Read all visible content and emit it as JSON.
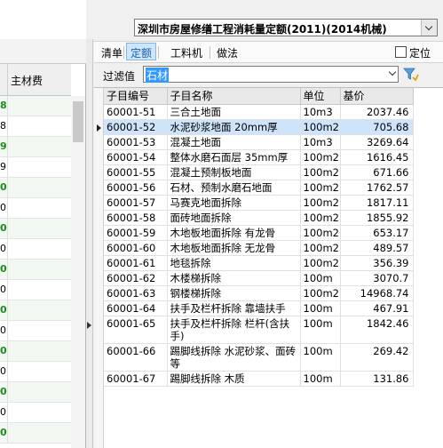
{
  "left_panel": {
    "column_header": "主材费",
    "rows": [
      {
        "text": "8",
        "green": true
      },
      {
        "text": "8",
        "green": false
      },
      {
        "text": "9",
        "green": true
      },
      {
        "text": "9",
        "green": false
      },
      {
        "text": "0",
        "green": true
      },
      {
        "text": "0",
        "green": false
      },
      {
        "text": "0",
        "green": true
      },
      {
        "text": "0",
        "green": false
      },
      {
        "text": "0",
        "green": true
      },
      {
        "text": "0",
        "green": false
      },
      {
        "text": "0",
        "green": true
      },
      {
        "text": "0",
        "green": false
      },
      {
        "text": "0",
        "green": true
      },
      {
        "text": "0",
        "green": false
      },
      {
        "text": "0",
        "green": true
      },
      {
        "text": "0",
        "green": false
      },
      {
        "text": "0",
        "green": true
      }
    ]
  },
  "quota_selector": {
    "value": "深圳市房屋修缮工程消耗量定额(2011)(2014机械)"
  },
  "toolbar": {
    "tabs": [
      {
        "label": "清单",
        "active": false
      },
      {
        "label": "定额",
        "active": true
      },
      {
        "label": "工料机",
        "active": false
      },
      {
        "label": "做法",
        "active": false
      }
    ],
    "locate_label": "定位",
    "locate_checked": false
  },
  "filter": {
    "label": "过滤值",
    "value": "石材"
  },
  "table": {
    "columns": [
      "子目编号",
      "子目名称",
      "单位",
      "基价"
    ],
    "selected_index": 1,
    "rows": [
      {
        "code": "60001-51",
        "name": "三合土地面",
        "unit": "10m3",
        "price": "2037.46"
      },
      {
        "code": "60001-52",
        "name": "水泥砂浆地面 20mm厚",
        "unit": "100m2",
        "price": "705.68"
      },
      {
        "code": "60001-53",
        "name": "混凝土地面",
        "unit": "10m3",
        "price": "3269.64"
      },
      {
        "code": "60001-54",
        "name": "整体水磨石面层 35mm厚",
        "unit": "100m2",
        "price": "1616.45"
      },
      {
        "code": "60001-55",
        "name": "混凝土预制板地面",
        "unit": "100m2",
        "price": "671.66"
      },
      {
        "code": "60001-56",
        "name": "石材、预制水磨石地面",
        "unit": "100m2",
        "price": "1762.57"
      },
      {
        "code": "60001-57",
        "name": "马赛克地面拆除",
        "unit": "100m2",
        "price": "1817.11"
      },
      {
        "code": "60001-58",
        "name": "面砖地面拆除",
        "unit": "100m2",
        "price": "1855.92"
      },
      {
        "code": "60001-59",
        "name": "木地板地面拆除 有龙骨",
        "unit": "100m2",
        "price": "653.17"
      },
      {
        "code": "60001-60",
        "name": "木地板地面拆除 无龙骨",
        "unit": "100m2",
        "price": "489.57"
      },
      {
        "code": "60001-61",
        "name": "地毯拆除",
        "unit": "100m2",
        "price": "356.39"
      },
      {
        "code": "60001-62",
        "name": "木楼梯拆除",
        "unit": "100m",
        "price": "3070.7"
      },
      {
        "code": "60001-63",
        "name": "钢楼梯拆除",
        "unit": "100m2",
        "price": "14968.74"
      },
      {
        "code": "60001-64",
        "name": "扶手及栏杆拆除 靠墙扶手",
        "unit": "100m",
        "price": "467.91"
      },
      {
        "code": "60001-65",
        "name": "扶手及栏杆拆除 栏杆(含扶手)",
        "unit": "100m",
        "price": "1842.46"
      },
      {
        "code": "60001-66",
        "name": "踢脚线拆除 水泥砂浆、面砖等",
        "unit": "100m",
        "price": "269.42"
      },
      {
        "code": "60001-67",
        "name": "踢脚线拆除 木质",
        "unit": "100m",
        "price": "131.86"
      }
    ]
  },
  "colors": {
    "accent": "#3399ff",
    "selected_row": "#cde4fb",
    "active_tab": "#cfe6fa",
    "left_green": "#1f8a1f"
  }
}
